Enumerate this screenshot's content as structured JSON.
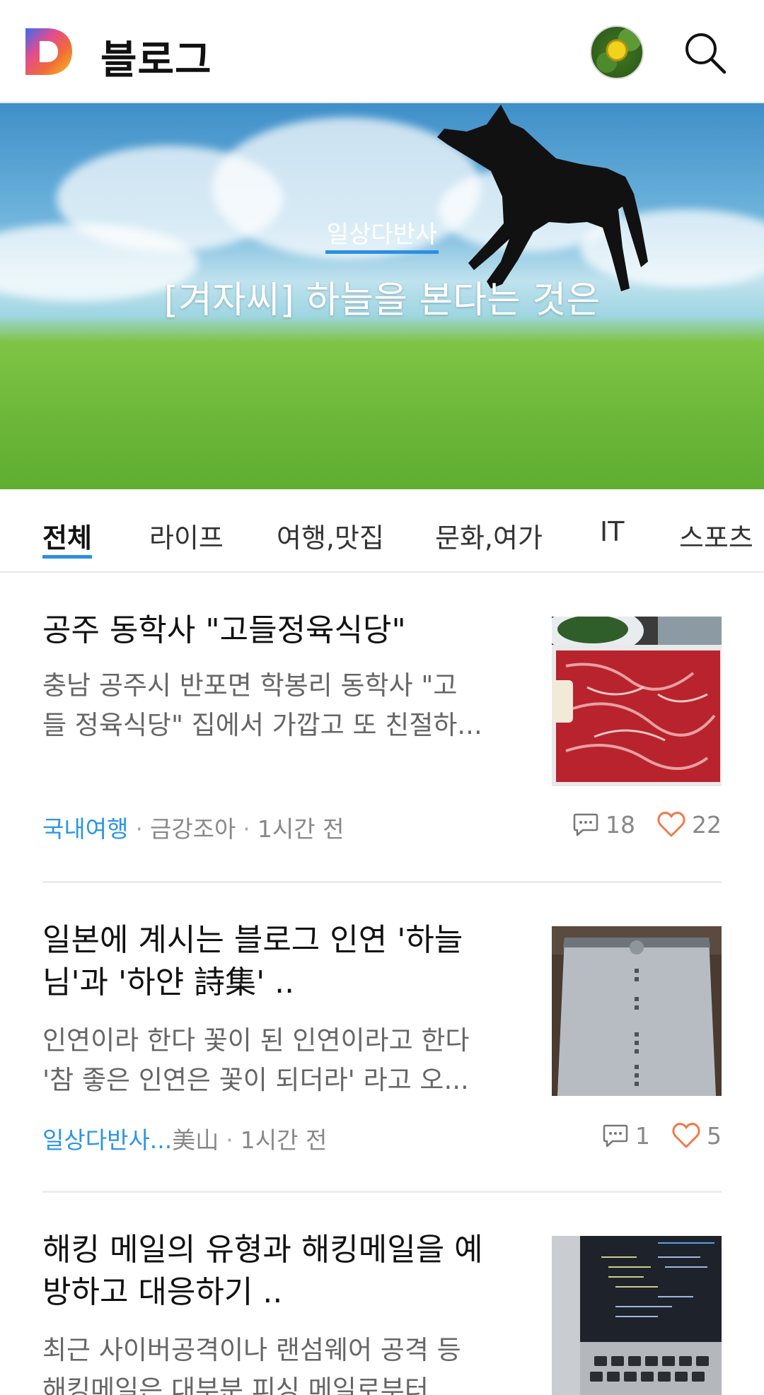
{
  "header": {
    "title": "블로그",
    "logo_icon": "daum-d-logo",
    "avatar_icon": "dandelion-avatar",
    "search_icon": "search-icon"
  },
  "hero": {
    "category": "일상다반사",
    "title": "[겨자씨] 하늘을 본다는 것은"
  },
  "tabs": [
    {
      "label": "전체",
      "active": true
    },
    {
      "label": "라이프",
      "active": false
    },
    {
      "label": "여행,맛집",
      "active": false
    },
    {
      "label": "문화,여가",
      "active": false
    },
    {
      "label": "IT",
      "active": false
    },
    {
      "label": "스포츠",
      "active": false
    }
  ],
  "articles": [
    {
      "title": "공주 동학사 \"고들정육식당\"",
      "summary_lines": [
        "충남 공주시 반포면 학봉리 동학사 \"고",
        "들 정육식당\" 집에서 가깝고 또 친절하..."
      ],
      "category": "국내여행",
      "author": "금강조아",
      "time": "1시간 전",
      "comments": "18",
      "likes": "22",
      "thumb": "raw-beef-photo"
    },
    {
      "title_lines": [
        "일본에 계시는 블로그 인연 '하늘",
        "님'과 '하얀 詩集' .."
      ],
      "summary_lines": [
        "인연이라 한다 꽃이 된 인연이라고 한다",
        "'참 좋은 인연은 꽃이 되더라' 라고 오..."
      ],
      "category": "일상다반사...",
      "author": "美山",
      "time": "1시간 전",
      "comments": "1",
      "likes": "5",
      "thumb": "poetry-book-photo"
    },
    {
      "title_lines": [
        "해킹 메일의 유형과 해킹메일을 예",
        "방하고 대응하기 .."
      ],
      "summary_lines": [
        "최근 사이버공격이나 랜섬웨어 공격 등",
        "해킹메일은 대부분 피싱 메일로부터"
      ],
      "thumb": "laptop-code-photo"
    }
  ],
  "colors": {
    "accent": "#2c8fe0",
    "category_text": "#2a96e3",
    "like_heart": "#f07a4a"
  }
}
